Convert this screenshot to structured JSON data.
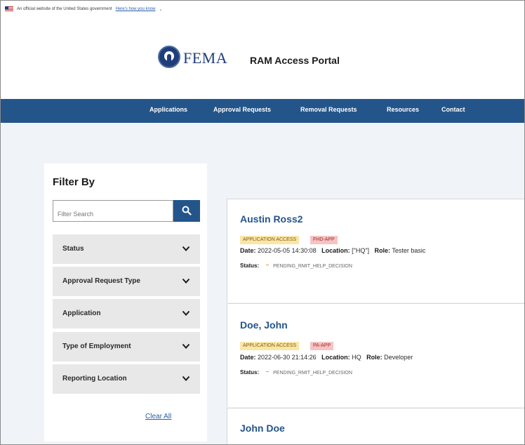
{
  "gov_banner": {
    "text": "An official website of the United States government",
    "link": "Here's how you know",
    "chevron": "⌄"
  },
  "header": {
    "agency": "FEMA",
    "title": "RAM Access Portal"
  },
  "nav": {
    "items": [
      "Applications",
      "Approval Requests",
      "Removal Requests",
      "Resources",
      "Contact"
    ]
  },
  "filter": {
    "title": "Filter By",
    "search_placeholder": "Filter Search",
    "sections": [
      "Status",
      "Approval Request Type",
      "Application",
      "Type of Employment",
      "Reporting Location"
    ],
    "clear_label": "Clear All"
  },
  "results": [
    {
      "name": "Austin Ross2",
      "badges": [
        "APPLICATION ACCESS",
        "FHD-APP"
      ],
      "date_label": "Date:",
      "date": "2022-05-05 14:30:08",
      "location_label": "Location:",
      "location": "[\"HQ\"]",
      "role_label": "Role:",
      "role": "Tester basic",
      "status_label": "Status:",
      "status": "PENDING_RMIT_HELP_DECISION"
    },
    {
      "name": "Doe, John",
      "badges": [
        "APPLICATION ACCESS",
        "PA-APP"
      ],
      "date_label": "Date:",
      "date": "2022-06-30 21:14:26",
      "location_label": "Location:",
      "location": "HQ",
      "role_label": "Role:",
      "role": "Developer",
      "status_label": "Status:",
      "status": "PENDING_RMIT_HELP_DECISION"
    },
    {
      "name": "John Doe"
    }
  ],
  "icons": {
    "search": "search-icon",
    "chevron": "chevron-down-icon",
    "flag": "us-flag-icon",
    "seal": "dhs-seal-icon"
  },
  "colors": {
    "nav_bg": "#24558a",
    "link": "#2b5ea8",
    "page_bg": "#f0f4f8",
    "badge_access": "#fbe6a8",
    "badge_app": "#f6c3c3"
  }
}
